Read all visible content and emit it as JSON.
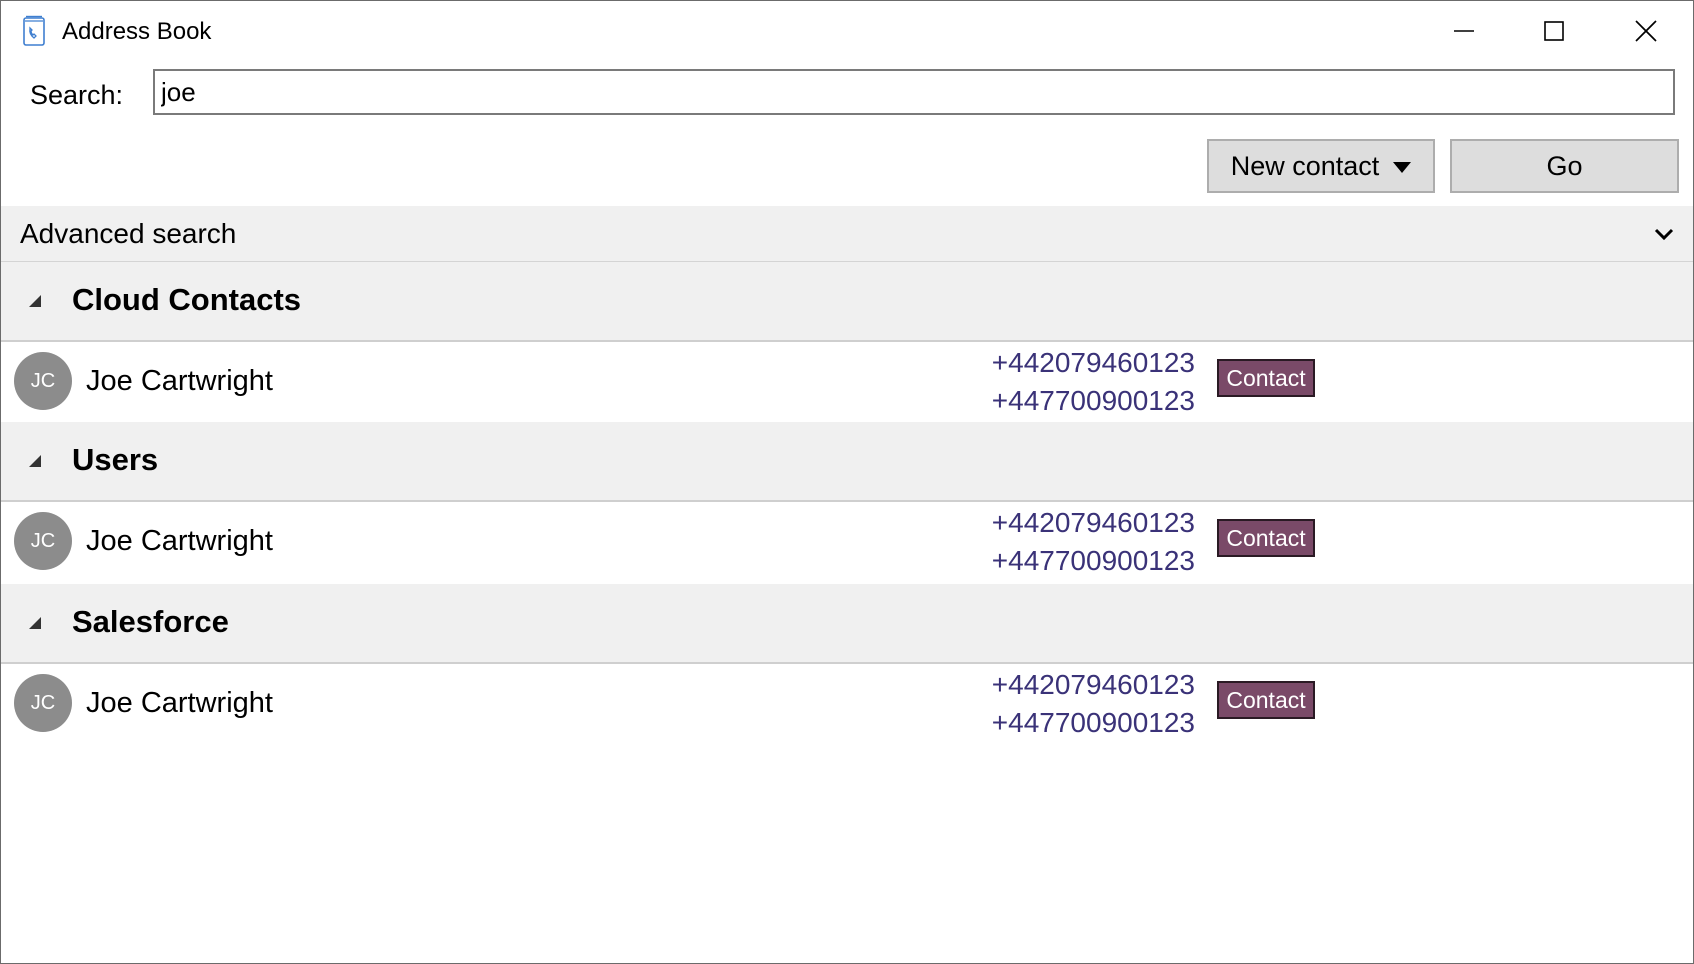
{
  "window": {
    "title": "Address Book",
    "icon": "address-book-icon"
  },
  "search": {
    "label": "Search:",
    "value": "joe"
  },
  "toolbar": {
    "new_contact_label": "New contact",
    "go_label": "Go"
  },
  "advanced_search": {
    "label": "Advanced search"
  },
  "groups": [
    {
      "title": "Cloud Contacts",
      "contact": {
        "initials": "JC",
        "name": "Joe Cartwright",
        "phones": [
          "+442079460123",
          "+447700900123"
        ],
        "tag": "Contact"
      }
    },
    {
      "title": "Users",
      "contact": {
        "initials": "JC",
        "name": "Joe Cartwright",
        "phones": [
          "+442079460123",
          "+447700900123"
        ],
        "tag": "Contact"
      }
    },
    {
      "title": "Salesforce",
      "contact": {
        "initials": "JC",
        "name": "Joe Cartwright",
        "phones": [
          "+442079460123",
          "+447700900123"
        ],
        "tag": "Contact"
      }
    }
  ],
  "colors": {
    "phone_text": "#3a3278",
    "tag_background": "#7a4a68",
    "avatar_background": "#8c8c8c",
    "group_background": "#f0f0f0"
  }
}
